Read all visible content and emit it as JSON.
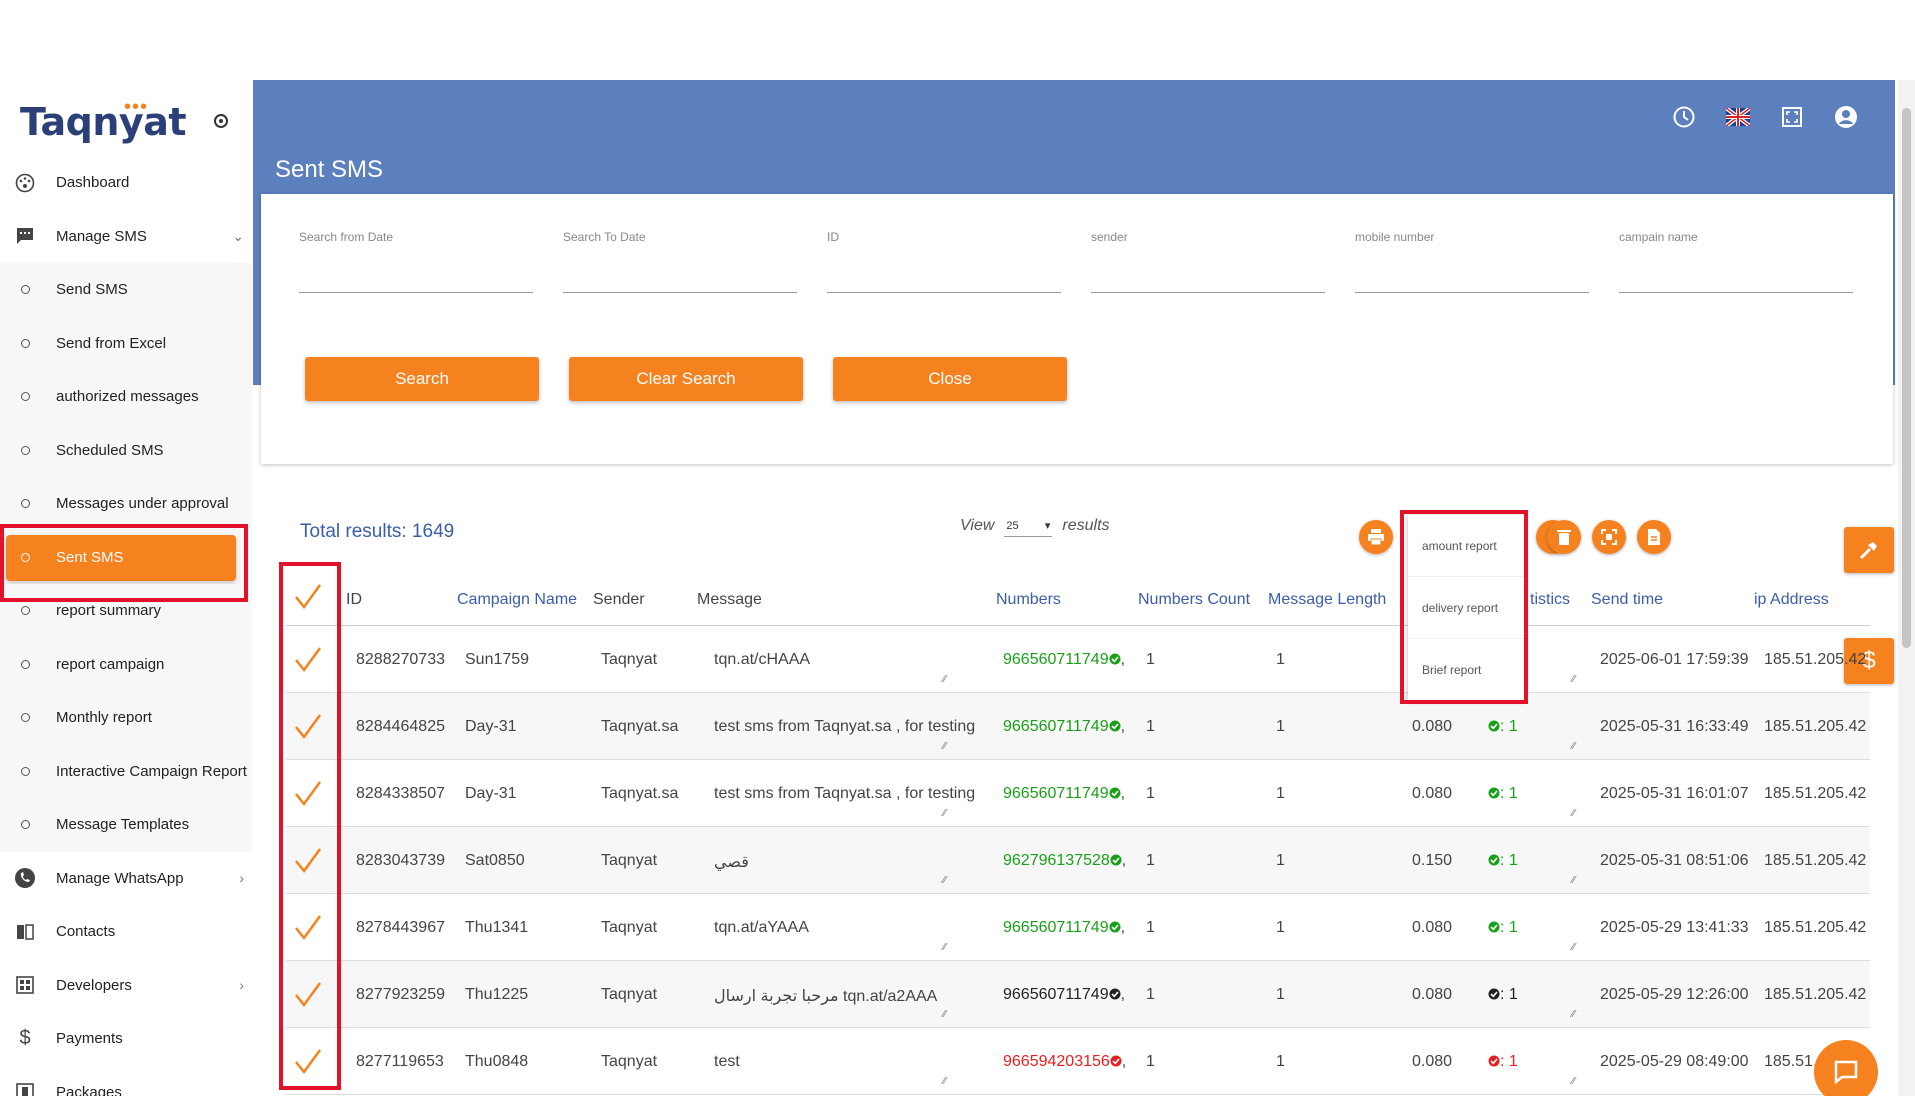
{
  "app": {
    "logo_text": "Taqnyat",
    "page_title": "Sent SMS"
  },
  "sidebar": {
    "items": [
      {
        "label": "Dashboard",
        "icon": "dashboard-icon",
        "type": "top"
      },
      {
        "label": "Manage SMS",
        "icon": "message-icon",
        "type": "top",
        "chevron": "⌄"
      },
      {
        "label": "Send SMS",
        "type": "sub"
      },
      {
        "label": "Send from Excel",
        "type": "sub"
      },
      {
        "label": "authorized messages",
        "type": "sub"
      },
      {
        "label": "Scheduled SMS",
        "type": "sub"
      },
      {
        "label": "Messages under approval",
        "type": "sub"
      },
      {
        "label": "Sent SMS",
        "type": "sub",
        "active": true
      },
      {
        "label": "report summary",
        "type": "sub"
      },
      {
        "label": "report campaign",
        "type": "sub"
      },
      {
        "label": "Monthly report",
        "type": "sub"
      },
      {
        "label": "Interactive Campaign Report",
        "type": "sub"
      },
      {
        "label": "Message Templates",
        "type": "sub"
      },
      {
        "label": "Manage WhatsApp",
        "icon": "whatsapp-icon",
        "type": "top",
        "chevron": "›"
      },
      {
        "label": "Contacts",
        "icon": "contacts-icon",
        "type": "top"
      },
      {
        "label": "Developers",
        "icon": "developers-icon",
        "type": "top",
        "chevron": "›"
      },
      {
        "label": "Payments",
        "icon": "dollar-icon",
        "type": "top"
      },
      {
        "label": "Packages",
        "icon": "packages-icon",
        "type": "top"
      }
    ]
  },
  "filters": {
    "from_date": "Search from Date",
    "to_date": "Search To Date",
    "id": "ID",
    "sender": "sender",
    "mobile": "mobile number",
    "campaign": "campain name",
    "search_btn": "Search",
    "clear_btn": "Clear Search",
    "close_btn": "Close"
  },
  "results": {
    "total_label": "Total results: 1649",
    "view_label": "View",
    "view_value": "25",
    "results_label": "results"
  },
  "report_menu": [
    "amount report",
    "delivery report",
    "Brief report"
  ],
  "table": {
    "headers": {
      "id": "ID",
      "campaign": "Campaign Name",
      "sender": "Sender",
      "message": "Message",
      "numbers": "Numbers",
      "count": "Numbers Count",
      "length": "Message Length",
      "stats": "tistics",
      "time": "Send time",
      "ip": "ip Address"
    },
    "rows": [
      {
        "id": "8288270733",
        "campaign": "Sun1759",
        "sender": "Taqnyat",
        "message": "tqn.at/cHAAA",
        "number": "966560711749",
        "status": "green",
        "count": "1",
        "length": "1",
        "cost": "",
        "stat": "",
        "time": "2025-06-01 17:59:39",
        "ip": "185.51.205.42"
      },
      {
        "id": "8284464825",
        "campaign": "Day-31",
        "sender": "Taqnyat.sa",
        "message": "test sms from Taqnyat.sa , for testing",
        "number": "966560711749",
        "status": "green",
        "count": "1",
        "length": "1",
        "cost": "0.080",
        "stat": ": 1",
        "time": "2025-05-31 16:33:49",
        "ip": "185.51.205.42"
      },
      {
        "id": "8284338507",
        "campaign": "Day-31",
        "sender": "Taqnyat.sa",
        "message": "test sms from Taqnyat.sa , for testing",
        "number": "966560711749",
        "status": "green",
        "count": "1",
        "length": "1",
        "cost": "0.080",
        "stat": ": 1",
        "time": "2025-05-31 16:01:07",
        "ip": "185.51.205.42"
      },
      {
        "id": "8283043739",
        "campaign": "Sat0850",
        "sender": "Taqnyat",
        "message": "قصي",
        "number": "962796137528",
        "status": "green",
        "count": "1",
        "length": "1",
        "cost": "0.150",
        "stat": ": 1",
        "time": "2025-05-31 08:51:06",
        "ip": "185.51.205.42"
      },
      {
        "id": "8278443967",
        "campaign": "Thu1341",
        "sender": "Taqnyat",
        "message": "tqn.at/aYAAA",
        "number": "966560711749",
        "status": "green",
        "count": "1",
        "length": "1",
        "cost": "0.080",
        "stat": ": 1",
        "time": "2025-05-29 13:41:33",
        "ip": "185.51.205.42"
      },
      {
        "id": "8277923259",
        "campaign": "Thu1225",
        "sender": "Taqnyat",
        "message": "مرحبا تجربة ارسال tqn.at/a2AAA",
        "number": "966560711749",
        "status": "black",
        "count": "1",
        "length": "1",
        "cost": "0.080",
        "stat": ": 1",
        "time": "2025-05-29 12:26:00",
        "ip": "185.51.205.42"
      },
      {
        "id": "8277119653",
        "campaign": "Thu0848",
        "sender": "Taqnyat",
        "message": "test",
        "number": "966594203156",
        "status": "red",
        "count": "1",
        "length": "1",
        "cost": "0.080",
        "stat": ": 1",
        "time": "2025-05-29 08:49:00",
        "ip": "185.51.20"
      }
    ]
  },
  "colors": {
    "header_blue": "#5c7fbd",
    "accent_orange": "#f5821f",
    "highlight_red": "#e3122b",
    "link_blue": "#3a5ea8"
  }
}
